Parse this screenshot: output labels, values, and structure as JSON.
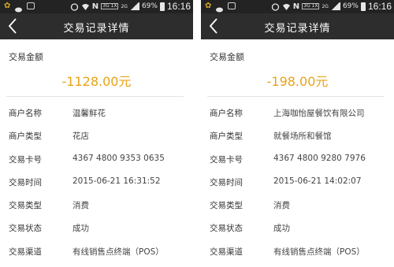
{
  "screens": [
    {
      "statusbar": {
        "time": "16:16",
        "battery": "69%",
        "net": "3G\n1X",
        "net2": "2G"
      },
      "title": "交易记录详情",
      "amount_label": "交易金额",
      "amount": "-1128.00元",
      "rows": [
        {
          "label": "商户名称",
          "value": "温馨鲜花"
        },
        {
          "label": "商户类型",
          "value": "花店"
        },
        {
          "label": "交易卡号",
          "value": "4367 4800 9353 0635"
        },
        {
          "label": "交易时间",
          "value": "2015-06-21 16:31:52"
        },
        {
          "label": "交易类型",
          "value": "消费"
        },
        {
          "label": "交易状态",
          "value": "成功"
        },
        {
          "label": "交易渠道",
          "value": "有线销售点终端（POS）"
        }
      ]
    },
    {
      "statusbar": {
        "time": "16:16",
        "battery": "69%",
        "net": "3G\n1X",
        "net2": "2G"
      },
      "title": "交易记录详情",
      "amount_label": "交易金额",
      "amount": "-198.00元",
      "rows": [
        {
          "label": "商户名称",
          "value": "上海咖怡屋餐饮有限公司"
        },
        {
          "label": "商户类型",
          "value": "就餐场所和餐馆"
        },
        {
          "label": "交易卡号",
          "value": "4367 4800 9280 7976"
        },
        {
          "label": "交易时间",
          "value": "2015-06-21 14:02:07"
        },
        {
          "label": "交易类型",
          "value": "消费"
        },
        {
          "label": "交易状态",
          "value": "成功"
        },
        {
          "label": "交易渠道",
          "value": "有线销售点终端（POS）"
        }
      ]
    }
  ],
  "colors": {
    "amount": "#e8a317",
    "titlebar": "#2d2d2d",
    "statusbar": "#232323"
  },
  "icons": [
    "clover-icon",
    "cloud-icon",
    "image-icon",
    "alarm-icon",
    "wifi-icon",
    "nfc-icon",
    "signal-icon",
    "battery-icon",
    "back-arrow-icon"
  ]
}
